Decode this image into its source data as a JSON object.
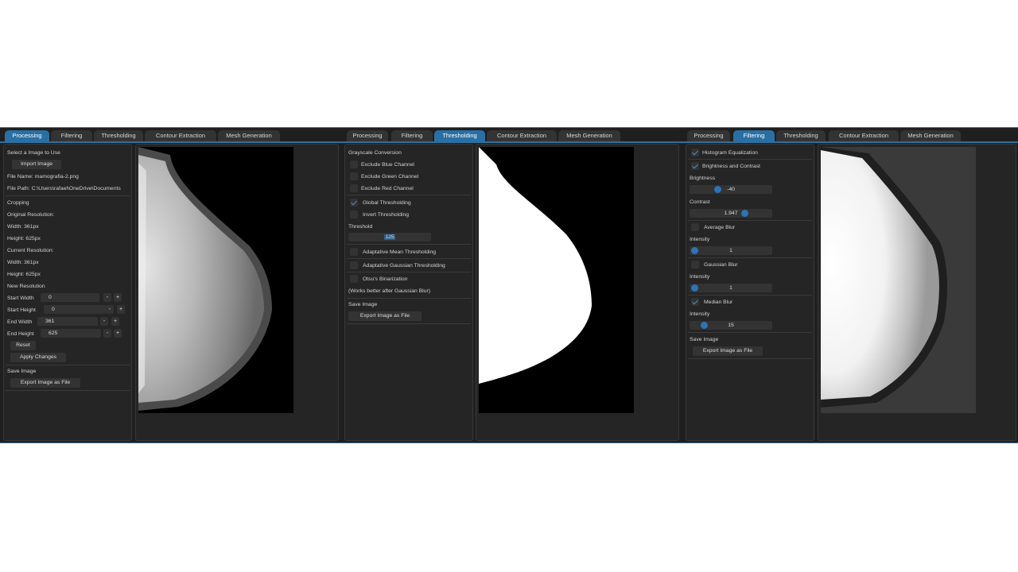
{
  "tabs": [
    "Processing",
    "Filtering",
    "Thresholding",
    "Contour Extraction",
    "Mesh Generation"
  ],
  "panels": {
    "processing": {
      "active_tab": "Processing",
      "select_label": "Select a Image to Use",
      "import_button": "Import Image",
      "file_name": "File Name: mamografia-2.png",
      "file_path": "File Path: C:\\Users\\rafael\\OneDrive\\Documents",
      "cropping_heading": "Cropping",
      "original_resolution_label": "Original Resolution:",
      "original_width": "Width: 361px",
      "original_height": "Height: 625px",
      "current_resolution_label": "Current Resolution:",
      "current_width": "Width: 361px",
      "current_height": "Height: 625px",
      "new_resolution_label": "New Resolution",
      "start_width_label": "Start Width",
      "start_width_value": "0",
      "start_height_label": "Start Height",
      "start_height_value": "0",
      "end_width_label": "End Width",
      "end_width_value": "361",
      "end_height_label": "End Height",
      "end_height_value": "625",
      "minus": "-",
      "plus": "+",
      "reset_button": "Reset",
      "apply_button": "Apply Changes",
      "save_heading": "Save Image",
      "export_button": "Export Image as File"
    },
    "thresholding": {
      "active_tab": "Thresholding",
      "grayscale_heading": "Grayscale Conversion",
      "exclude_blue": "Exclude Blue Channel",
      "exclude_green": "Exclude Green Channel",
      "exclude_red": "Exclude Red Channel",
      "global_thresholding": "Global Thresholding",
      "invert_thresholding": "Invert Thresholding",
      "threshold_label": "Threshold",
      "threshold_value": "125",
      "adaptive_mean": "Adaptative Mean Thresholding",
      "adaptive_gaussian": "Adaptative Gaussian Thresholding",
      "otsu": "Otsu's Binarization",
      "otsu_note": "(Works better after Gaussian Blur)",
      "save_heading": "Save Image",
      "export_button": "Export Image as File"
    },
    "filtering": {
      "active_tab": "Filtering",
      "histogram_equalization": "Histogram Equalization",
      "brightness_contrast": "Brightness and Contrast",
      "brightness_label": "Brightness",
      "brightness_value": "-40",
      "contrast_label": "Contrast",
      "contrast_value": "1.947",
      "average_blur": "Average Blur",
      "average_intensity_label": "Intensity",
      "average_intensity_value": "1",
      "gaussian_blur": "Gaussian Blur",
      "gaussian_intensity_label": "Intensity",
      "gaussian_intensity_value": "1",
      "median_blur": "Median Blur",
      "median_intensity_label": "Intensity",
      "median_intensity_value": "15",
      "save_heading": "Save Image",
      "export_button": "Export Image as File"
    }
  },
  "colors": {
    "background": "#1f1f1f",
    "tab_active": "#2a6fa3",
    "accent": "#2e73b5"
  }
}
